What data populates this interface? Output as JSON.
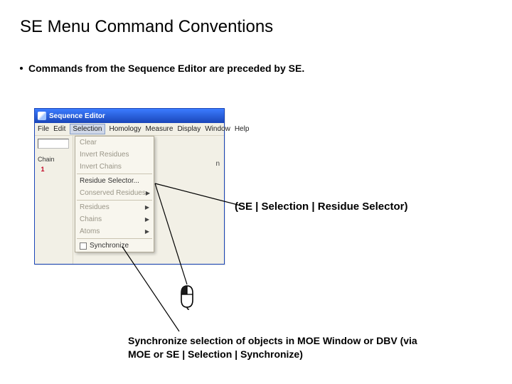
{
  "title": "SE Menu Command Conventions",
  "bullet": "Commands from the Sequence Editor are preceded by SE.",
  "se_window": {
    "title": "Sequence Editor",
    "menubar": [
      "File",
      "Edit",
      "Selection",
      "Homology",
      "Measure",
      "Display",
      "Window",
      "Help"
    ],
    "chain_label": "Chain",
    "chain_value": "1",
    "right_letter": "n"
  },
  "dropdown": {
    "items": [
      {
        "label": "Clear",
        "disabled": true
      },
      {
        "label": "Invert Residues",
        "disabled": true
      },
      {
        "label": "Invert Chains",
        "disabled": true
      },
      {
        "sep": true
      },
      {
        "label": "Residue Selector...",
        "disabled": false
      },
      {
        "label": "Conserved Residues",
        "disabled": true,
        "sub": true
      },
      {
        "sep": true
      },
      {
        "label": "Residues",
        "disabled": true,
        "sub": true
      },
      {
        "label": "Chains",
        "disabled": true,
        "sub": true
      },
      {
        "label": "Atoms",
        "disabled": true,
        "sub": true
      },
      {
        "sep": true
      },
      {
        "label": "Synchronize",
        "disabled": false,
        "check": true
      }
    ]
  },
  "annotation_path": "(SE | Selection | Residue Selector)",
  "annotation_sync": "Synchronize selection of objects in MOE Window or DBV (via MOE or SE | Selection | Synchronize)",
  "icons": {
    "mouse": "mouse-icon",
    "app": "sequence-editor-icon"
  }
}
